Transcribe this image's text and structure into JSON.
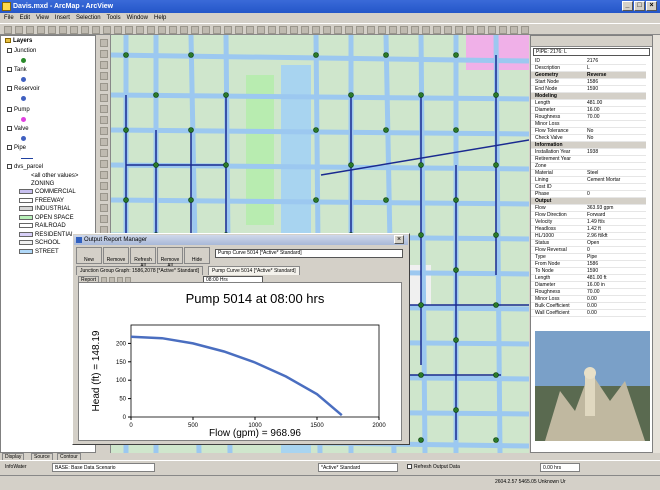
{
  "window": {
    "title": "Davis.mxd - ArcMap - ArcView",
    "min": "_",
    "max": "□",
    "close": "×"
  },
  "menu": [
    "File",
    "Edit",
    "View",
    "Insert",
    "Selection",
    "Tools",
    "Window",
    "Help"
  ],
  "toc": {
    "header": "Layers",
    "layers": [
      {
        "name": "Junction",
        "symbol": "dot"
      },
      {
        "name": "Tank",
        "symbol": "tank"
      },
      {
        "name": "Reservoir",
        "symbol": "res"
      },
      {
        "name": "Pump",
        "symbol": "pump"
      },
      {
        "name": "Valve",
        "symbol": "valve"
      },
      {
        "name": "Pipe",
        "symbol": "line"
      },
      {
        "name": "dvs_parcel",
        "symbol": "none"
      }
    ],
    "legend_header": "<all other values>",
    "zoning": "ZONING",
    "legend": [
      {
        "label": "COMMERCIAL",
        "color": "#c8c0f0"
      },
      {
        "label": "FREEWAY",
        "color": "#ffffff"
      },
      {
        "label": "INDUSTRIAL",
        "color": "#d8d8d8"
      },
      {
        "label": "OPEN SPACE",
        "color": "#b8f0b8"
      },
      {
        "label": "RAILROAD",
        "color": "#ffffff"
      },
      {
        "label": "RESIDENTIAL",
        "color": "#d8d0f8"
      },
      {
        "label": "SCHOOL",
        "color": "#f0f0f0"
      },
      {
        "label": "STREET",
        "color": "#b0d8f8"
      }
    ]
  },
  "props": {
    "title": "PIPE: 2176: L",
    "rows": [
      {
        "k": "ID",
        "v": "2176",
        "s": false
      },
      {
        "k": "Description",
        "v": "L",
        "s": false
      },
      {
        "k": "Geometry",
        "v": "Reverse",
        "s": true
      },
      {
        "k": "Start Node",
        "v": "1586",
        "s": false
      },
      {
        "k": "End Node",
        "v": "1590",
        "s": false
      },
      {
        "k": "Modeling",
        "v": "",
        "s": true
      },
      {
        "k": "Length",
        "v": "481.00",
        "s": false
      },
      {
        "k": "Diameter",
        "v": "16.00",
        "s": false
      },
      {
        "k": "Roughness",
        "v": "70.00",
        "s": false
      },
      {
        "k": "Minor Loss",
        "v": "",
        "s": false
      },
      {
        "k": "Flow Tolerance",
        "v": "No",
        "s": false
      },
      {
        "k": "Check Valve",
        "v": "No",
        "s": false
      },
      {
        "k": "Information",
        "v": "",
        "s": true
      },
      {
        "k": "Installation Year",
        "v": "1938",
        "s": false
      },
      {
        "k": "Retirement Year",
        "v": "",
        "s": false
      },
      {
        "k": "Zone",
        "v": "",
        "s": false
      },
      {
        "k": "Material",
        "v": "Steel",
        "s": false
      },
      {
        "k": "Lining",
        "v": "Cement Mortar",
        "s": false
      },
      {
        "k": "Cost ID",
        "v": "",
        "s": false
      },
      {
        "k": "Phase",
        "v": "0",
        "s": false
      },
      {
        "k": "Output",
        "v": "",
        "s": true
      },
      {
        "k": "Flow",
        "v": "363.93 gpm",
        "s": false
      },
      {
        "k": "Flow Direction",
        "v": "Forward",
        "s": false
      },
      {
        "k": "Velocity",
        "v": "1.49 ft/s",
        "s": false
      },
      {
        "k": "Headloss",
        "v": "1.42 ft",
        "s": false
      },
      {
        "k": "HL/1000",
        "v": "2.96 ft/kft",
        "s": false
      },
      {
        "k": "Status",
        "v": "Open",
        "s": false
      },
      {
        "k": "Flow Reversal",
        "v": "0",
        "s": false
      },
      {
        "k": "Type",
        "v": "Pipe",
        "s": false
      },
      {
        "k": "From Node",
        "v": "1586",
        "s": false
      },
      {
        "k": "To Node",
        "v": "1590",
        "s": false
      },
      {
        "k": "Length",
        "v": "481.00 ft",
        "s": false
      },
      {
        "k": "Diameter",
        "v": "16.00 in",
        "s": false
      },
      {
        "k": "Roughness",
        "v": "70.00",
        "s": false
      },
      {
        "k": "Minor Loss",
        "v": "0.00",
        "s": false
      },
      {
        "k": "Bulk Coefficient",
        "v": "0.00",
        "s": false
      },
      {
        "k": "Wall Coefficient",
        "v": "0.00",
        "s": false
      }
    ]
  },
  "orm": {
    "title": "Output Report Manager",
    "buttons": [
      "New",
      "Remove",
      "Refresh All",
      "Remove All",
      "Hide"
    ],
    "selector": "Pump Curve 5014 [*Active* Standard]",
    "tabs": [
      "Junction Group Graph: 1586,2078 [*Active* Standard]",
      "Pump Curve 5014 [*Active* Standard]"
    ],
    "report_btn": "Report",
    "timecombo": "08:00 Hrs"
  },
  "chart_data": {
    "type": "line",
    "title": "Pump 5014 at 08:00 hrs",
    "xlabel": "Flow (gpm) = 968.96",
    "ylabel": "Head (ft) = 148.19",
    "xlim": [
      0,
      2000
    ],
    "ylim": [
      0,
      250
    ],
    "xticks": [
      "0",
      "500",
      "1000",
      "1500",
      "2000"
    ],
    "yticks": [
      "0",
      "50",
      "100",
      "150",
      "200"
    ],
    "series": [
      {
        "x": [
          0,
          250,
          500,
          750,
          1000,
          1250,
          1500,
          1700
        ],
        "y": [
          218,
          214,
          200,
          178,
          148,
          110,
          62,
          5
        ]
      }
    ]
  },
  "status": {
    "infowater": "InfoWater",
    "scenario": "BASE: Base Data Scenario",
    "active": "*Active* Standard",
    "refresh": "Refresh Output Data",
    "time": "0.00 hrs",
    "coords": "2604.2.57  5465.05 Unknown Ur",
    "tabs": [
      "Display",
      "Source",
      "Contour"
    ]
  }
}
